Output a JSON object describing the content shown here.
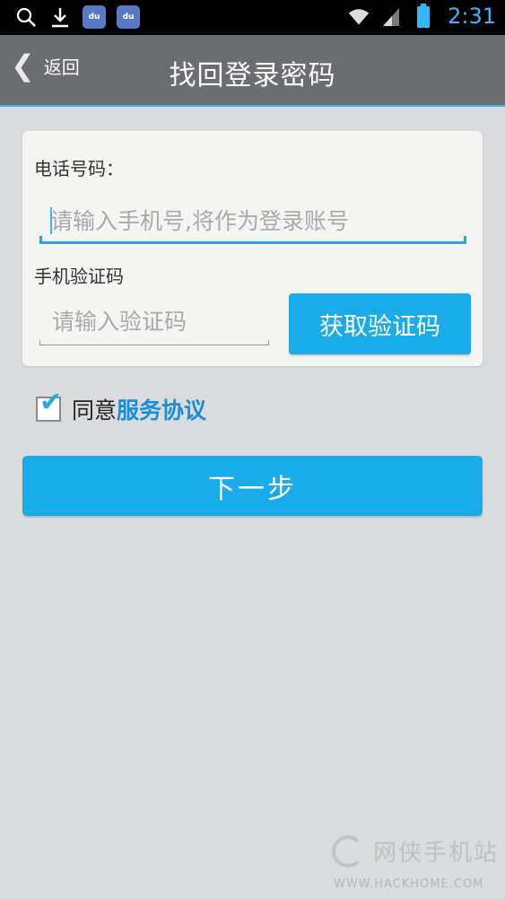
{
  "status_bar": {
    "time": "2:31",
    "icons": [
      "search-icon",
      "download-icon",
      "baidu-icon",
      "baidu-icon",
      "wifi-icon",
      "signal-icon",
      "battery-icon"
    ],
    "badge_text": "du"
  },
  "header": {
    "back_label": "返回",
    "title": "找回登录密码"
  },
  "form": {
    "phone_label": "电话号码：",
    "phone_placeholder": "请输入手机号,将作为登录账号",
    "code_label": "手机验证码",
    "code_placeholder": "请输入验证码",
    "get_code_button": "获取验证码"
  },
  "agreement": {
    "checked": true,
    "text": "同意",
    "link": "服务协议"
  },
  "next_button": "下一步",
  "watermark": {
    "name": "网侠手机站",
    "url": "WWW.HACKHOME.COM"
  },
  "colors": {
    "accent": "#1aacea",
    "title_bar": "#6b6d70",
    "background": "#d9dbdc",
    "link": "#1a8fd6"
  }
}
